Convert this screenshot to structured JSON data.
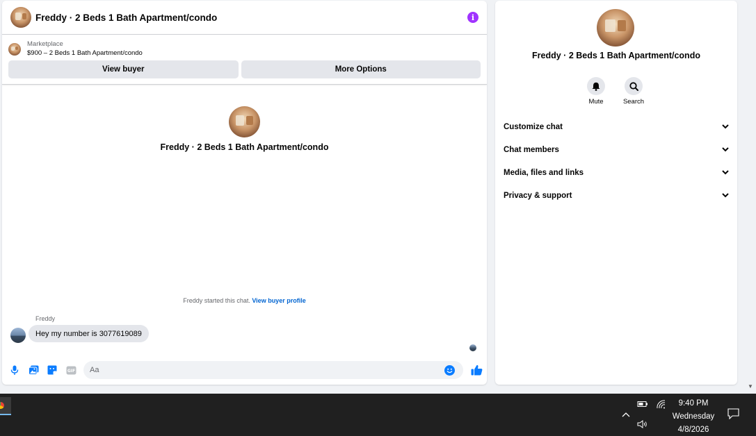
{
  "chat": {
    "header_title": "Freddy · 2 Beds 1 Bath Apartment/condo",
    "marketplace_label": "Marketplace",
    "listing": "$900 – 2 Beds 1 Bath Apartment/condo",
    "view_buyer_label": "View buyer",
    "more_options_label": "More Options",
    "profile_name": "Freddy · 2 Beds 1 Bath Apartment/condo",
    "started_text": "Freddy started this chat.",
    "view_profile_link": "View buyer profile",
    "messages": [
      {
        "sender": "Freddy",
        "text": "Hey my number is 3077619089"
      }
    ],
    "composer_placeholder": "Aa"
  },
  "info_panel": {
    "name": "Freddy · 2 Beds 1 Bath Apartment/condo",
    "actions": [
      {
        "label": "Mute",
        "icon": "bell-icon"
      },
      {
        "label": "Search",
        "icon": "search-icon"
      }
    ],
    "sections": [
      {
        "label": "Customize chat"
      },
      {
        "label": "Chat members"
      },
      {
        "label": "Media, files and links"
      },
      {
        "label": "Privacy & support"
      }
    ]
  },
  "taskbar": {
    "time": "9:40 PM",
    "day": "Wednesday",
    "date": "4/8/2026"
  },
  "colors": {
    "accent": "#0a7cff",
    "info_icon": "#a033ff",
    "link": "#0064d1",
    "taskbar": "#202020"
  }
}
